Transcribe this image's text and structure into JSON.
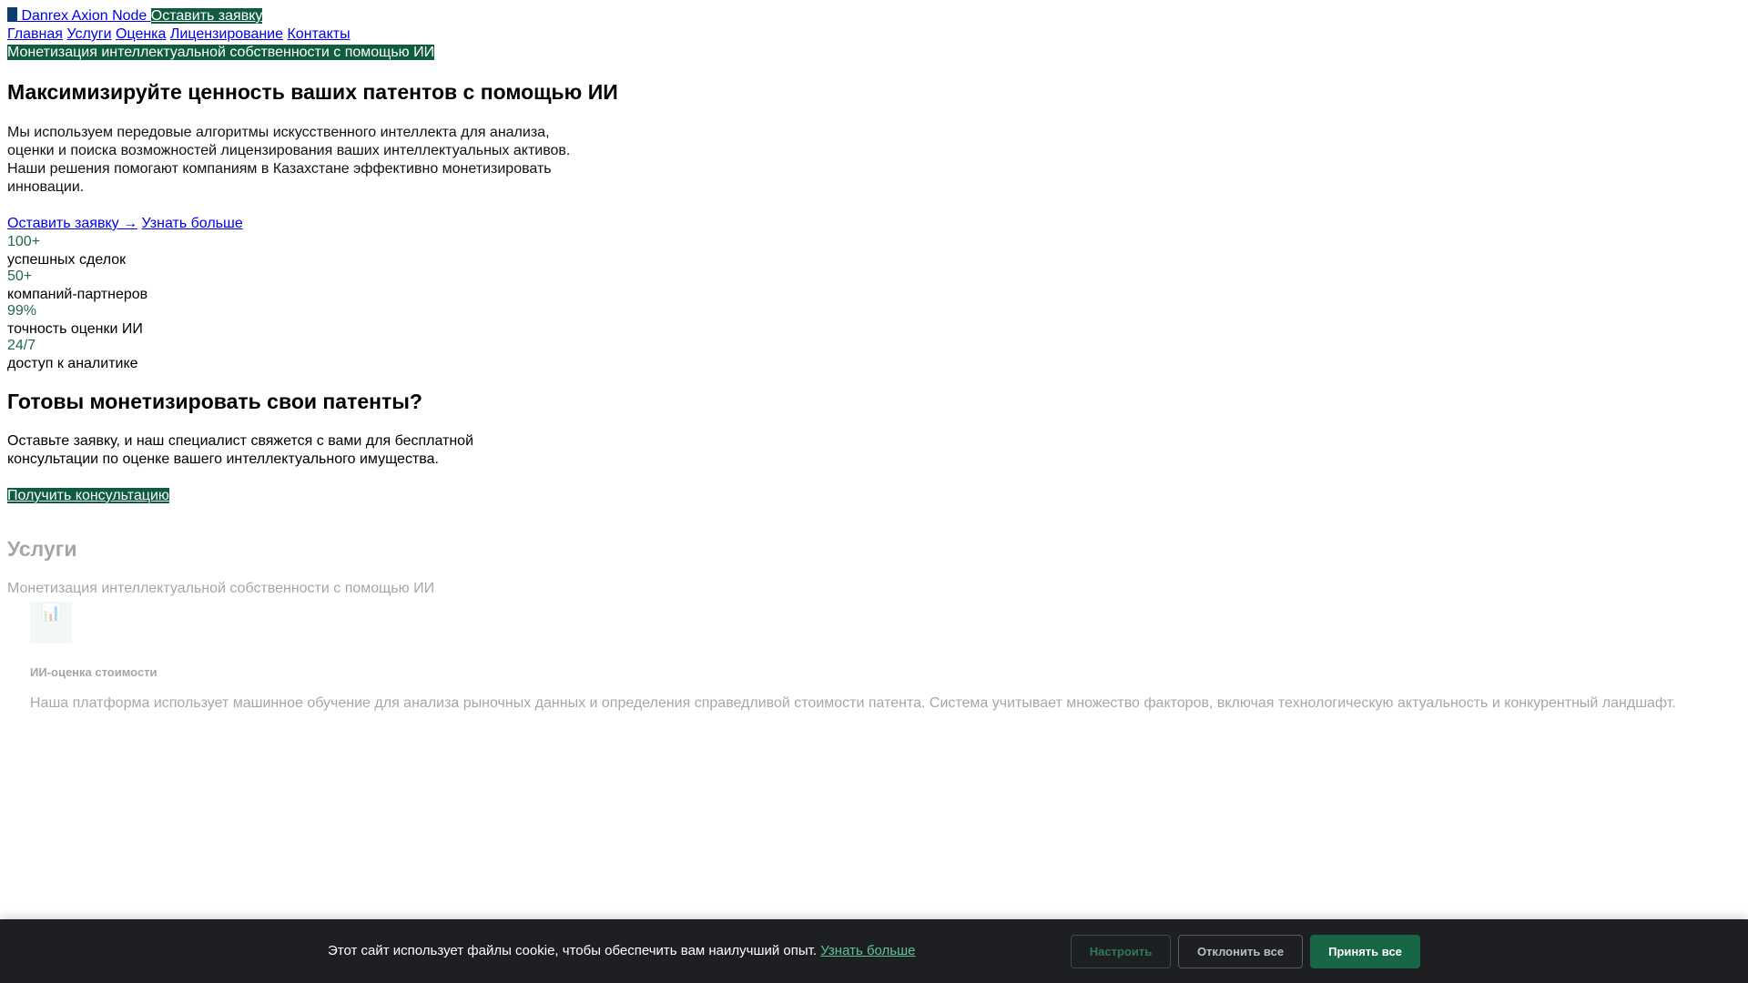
{
  "header": {
    "brand": "Danrex Axion Node",
    "cta": "Оставить заявку"
  },
  "nav": {
    "items": [
      "Главная",
      "Услуги",
      "Оценка",
      "Лицензирование",
      "Контакты"
    ]
  },
  "tagline": "Монетизация интеллектуальной собственности с помощью ИИ",
  "hero": {
    "title": "Максимизируйте ценность ваших патентов с помощью ИИ",
    "description": "Мы используем передовые алгоритмы искусственного интеллекта для анализа, оценки и поиска возможностей лицензирования ваших интеллектуальных активов. Наши решения помогают компаниям в Казахстане эффективно монетизировать инновации.",
    "primary_link": "Оставить заявку →",
    "secondary_link": "Узнать больше"
  },
  "stats": [
    {
      "value": "100+",
      "label": "успешных сделок"
    },
    {
      "value": "50+",
      "label": "компаний-партнеров"
    },
    {
      "value": "99%",
      "label": "точность оценки ИИ"
    },
    {
      "value": "24/7",
      "label": "доступ к аналитике"
    }
  ],
  "cta_section": {
    "title": "Готовы монетизировать свои патенты?",
    "description": "Оставьте заявку, и наш специалист свяжется с вами для бесплатной консультации по оценке вашего интеллектуального имущества.",
    "button": "Получить консультацию"
  },
  "services": {
    "title": "Услуги",
    "subtitle": "Монетизация интеллектуальной собственности с помощью ИИ",
    "cards": [
      {
        "icon": "bar-chart-icon",
        "icon_glyph": "📊",
        "title": "ИИ-оценка стоимости",
        "description": "Наша платформа использует машинное обучение для анализа рыночных данных и определения справедливой стоимости патента. Система учитывает множество факторов, включая технологическую актуальность и конкурентный ландшафт."
      }
    ]
  },
  "cookie_banner": {
    "text": "Этот сайт использует файлы cookie, чтобы обеспечить вам наилучший опыт.",
    "learn_more": "Узнать больше",
    "customize": "Настроить",
    "reject": "Отклонить все",
    "accept": "Принять все"
  },
  "colors": {
    "brand_green": "#0f5c3f",
    "accent_green": "#1e6b47",
    "cookie_bg": "#1e1f22",
    "logo_blue": "#0b3d6e"
  }
}
